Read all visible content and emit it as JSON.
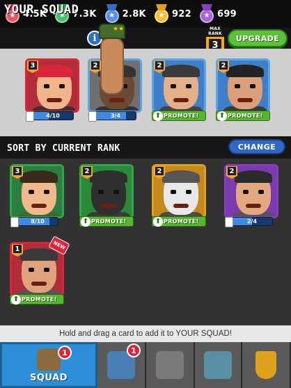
{
  "currencies": [
    {
      "name": "red-medal",
      "value": "4.5K",
      "ribbon": "#d9263a",
      "disc": "#e05a6a",
      "glyph": "★"
    },
    {
      "name": "green-medal",
      "value": "7.3K",
      "ribbon": "#2da84a",
      "disc": "#49c06a",
      "glyph": "★"
    },
    {
      "name": "blue-medal",
      "value": "2.8K",
      "ribbon": "#2f6fc9",
      "disc": "#5b90de",
      "glyph": "★"
    },
    {
      "name": "gold-medal",
      "value": "922",
      "ribbon": "#e0a21a",
      "disc": "#f0c040",
      "glyph": "★"
    },
    {
      "name": "purple-medal",
      "value": "699",
      "ribbon": "#8a3dc2",
      "disc": "#a865d6",
      "glyph": "★"
    }
  ],
  "squad_header": {
    "title": "YOUR SQUAD",
    "info": "i",
    "max_rank_label": "MAX RANK",
    "max_rank": "3",
    "upgrade_label": "UPGRADE"
  },
  "squad_cards": [
    {
      "rank": "3",
      "border": "#d9263a",
      "bg": "#b22d3a",
      "skin": "#f0b48a",
      "hair": "#d9263a",
      "shirt": "#333",
      "status": "progress",
      "progress_text": "4/10",
      "progress": 0.4
    },
    {
      "rank": "2",
      "border": "#5aa4e8",
      "bg": "#6f6f6f",
      "skin": "#6b4a33",
      "hair": "#333",
      "shirt": "#333",
      "status": "progress",
      "progress_text": "3/4",
      "progress": 0.75,
      "dragging": true
    },
    {
      "rank": "2",
      "border": "#5aa4e8",
      "bg": "#3f7ec8",
      "skin": "#e3b089",
      "hair": "#3a3a3a",
      "shirt": "#444",
      "status": "promote",
      "promote_label": "PROMOTE!"
    },
    {
      "rank": "2",
      "border": "#5aa4e8",
      "bg": "#3f7ec8",
      "skin": "#d9a07a",
      "hair": "#222",
      "shirt": "#3a3a3a",
      "status": "promote",
      "promote_label": "PROMOTE!"
    }
  ],
  "sort": {
    "title": "SORT BY CURRENT RANK",
    "change_label": "CHANGE"
  },
  "collection_cards": [
    {
      "rank": "3",
      "border": "#2da84a",
      "bg": "#2c7d3f",
      "skin": "#f2b98f",
      "hair": "#3a2a1c",
      "shirt": "#3f6b2a",
      "status": "progress",
      "progress_text": "8/10",
      "progress": 0.8
    },
    {
      "rank": "2",
      "border": "#2da84a",
      "bg": "#2b8a3a",
      "skin": "#2f2f2f",
      "hair": "#2f2f2f",
      "shirt": "#3a3a3a",
      "status": "promote",
      "promote_label": "PROMOTE!"
    },
    {
      "rank": "2",
      "border": "#e0a21a",
      "bg": "#c48a1e",
      "skin": "#e8e8e8",
      "hair": "#555",
      "shirt": "#4a4a4a",
      "status": "promote",
      "promote_label": "PROMOTE!"
    },
    {
      "rank": "2",
      "border": "#8a3dc2",
      "bg": "#7a3ab0",
      "skin": "#e3a981",
      "hair": "#2a2a2a",
      "shirt": "#555",
      "status": "progress",
      "progress_text": "2/4",
      "progress": 0.5
    },
    {
      "rank": "1",
      "border": "#d9263a",
      "bg": "#b22d3a",
      "skin": "#e0a27a",
      "hair": "#3a3a3a",
      "shirt": "#555",
      "status": "promote",
      "promote_label": "PROMOTE!",
      "new_label": "NEW"
    }
  ],
  "hint": "Hold and drag a card to add it to YOUR SQUAD!",
  "tabs": [
    {
      "name": "squad",
      "label": "SQUAD",
      "notif": "1",
      "active": true,
      "glyph_color": "#8b6a3e"
    },
    {
      "name": "cards",
      "label": "",
      "notif": "1",
      "active": false,
      "glyph_color": "#4a7fb5"
    },
    {
      "name": "base",
      "label": "",
      "notif": "",
      "active": false,
      "glyph_color": "#7a7a7a"
    },
    {
      "name": "missions",
      "label": "",
      "notif": "",
      "active": false,
      "glyph_color": "#5a8fa8"
    },
    {
      "name": "trophies",
      "label": "",
      "notif": "",
      "active": false,
      "glyph_color": "#e0a21a"
    }
  ]
}
